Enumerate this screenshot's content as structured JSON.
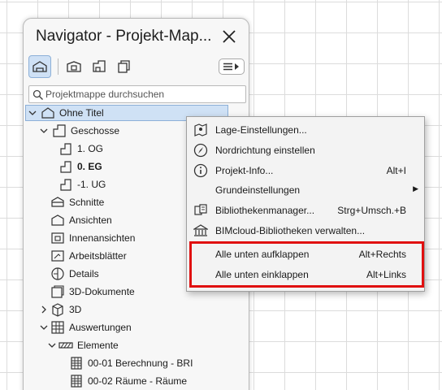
{
  "navigator": {
    "title": "Navigator - Projekt-Map...",
    "search_placeholder": "Projektmappe durchsuchen",
    "tree": {
      "root": "Ohne Titel",
      "geschosse": "Geschosse",
      "stories": [
        "1. OG",
        "0. EG",
        "-1. UG"
      ],
      "schnitte": "Schnitte",
      "ansichten": "Ansichten",
      "innenansichten": "Innenansichten",
      "arbeitsblaetter": "Arbeitsblätter",
      "details": "Details",
      "dokumente3d": "3D-Dokumente",
      "d3": "3D",
      "auswertungen": "Auswertungen",
      "elemente": "Elemente",
      "schedules": [
        "00-01 Berechnung - BRI",
        "00-02 Räume - Räume"
      ]
    }
  },
  "context_menu": {
    "items": [
      {
        "label": "Lage-Einstellungen...",
        "icon": "location-settings-icon"
      },
      {
        "label": "Nordrichtung einstellen",
        "icon": "compass-icon"
      },
      {
        "label": "Projekt-Info...",
        "shortcut": "Alt+I",
        "icon": "info-icon"
      },
      {
        "label": "Grundeinstellungen",
        "has_submenu": true
      },
      {
        "label": "Bibliothekenmanager...",
        "shortcut": "Strg+Umsch.+B",
        "icon": "library-manager-icon"
      },
      {
        "label": "BIMcloud-Bibliotheken verwalten...",
        "icon": "bimcloud-library-icon"
      },
      {
        "label": "Alle unten aufklappen",
        "shortcut": "Alt+Rechts"
      },
      {
        "label": "Alle unten einklappen",
        "shortcut": "Alt+Links"
      }
    ]
  },
  "colors": {
    "selection": "#cfe1f5",
    "highlight": "#e01010",
    "grid": "#dcdcdc"
  }
}
